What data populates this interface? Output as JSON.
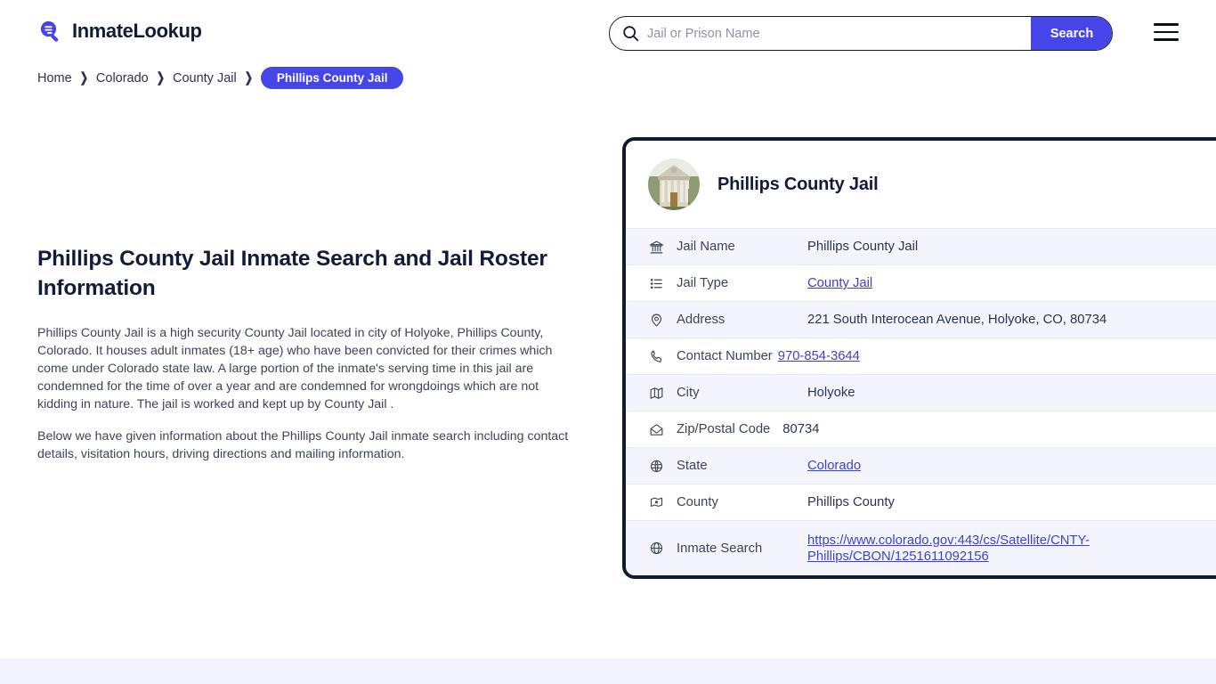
{
  "brand": {
    "name": "InmateLookup",
    "logo_icon": "magnifier-logo-icon"
  },
  "search": {
    "placeholder": "Jail or Prison Name",
    "value": "",
    "button_label": "Search",
    "icon": "search-icon"
  },
  "menu": {
    "icon": "hamburger-menu-icon"
  },
  "breadcrumb": {
    "items": [
      {
        "label": "Home"
      },
      {
        "label": "Colorado"
      },
      {
        "label": "County Jail"
      }
    ],
    "separator": "❯",
    "current": "Phillips County Jail"
  },
  "article": {
    "heading": "Phillips County Jail Inmate Search and Jail Roster Information",
    "paragraphs": [
      "Phillips County Jail is a high security County Jail located in city of Holyoke, Phillips County, Colorado. It houses adult inmates (18+ age) who have been convicted for their crimes which come under Colorado state law. A large portion of the inmate's serving time in this jail are condemned for the time of over a year and are condemned for wrongdoings which are not kidding in nature. The jail is worked and kept up by County Jail .",
      "Below we have given information about the Phillips County Jail inmate search including contact details, visitation hours, driving directions and mailing information."
    ]
  },
  "card": {
    "title": "Phillips County Jail",
    "avatar_icon": "courthouse-photo",
    "rows": [
      {
        "icon": "bank-icon",
        "label": "Jail Name",
        "value": "Phillips County Jail",
        "link": false
      },
      {
        "icon": "list-icon",
        "label": "Jail Type",
        "value": "County Jail",
        "link": true
      },
      {
        "icon": "map-pin-icon",
        "label": "Address",
        "value": "221 South Interocean Avenue, Holyoke, CO, 80734",
        "link": false
      },
      {
        "icon": "phone-icon",
        "label": "Contact Number",
        "value": "970-854-3644",
        "link": true
      },
      {
        "icon": "map-icon",
        "label": "City",
        "value": "Holyoke",
        "link": false
      },
      {
        "icon": "envelope-icon",
        "label": "Zip/Postal Code",
        "value": "80734",
        "link": false
      },
      {
        "icon": "globe-icon",
        "label": "State",
        "value": "Colorado",
        "link": true
      },
      {
        "icon": "county-pin-icon",
        "label": "County",
        "value": "Phillips County",
        "link": false
      },
      {
        "icon": "world-icon",
        "label": "Inmate Search",
        "value": "https://www.colorado.gov:443/cs/Satellite/CNTY-Phillips/CBON/1251611092156",
        "link": true
      }
    ]
  },
  "colors": {
    "accent": "#4646e8",
    "link": "#4040d0",
    "dark": "#131b3a",
    "row_alt": "#f4f5fc"
  }
}
